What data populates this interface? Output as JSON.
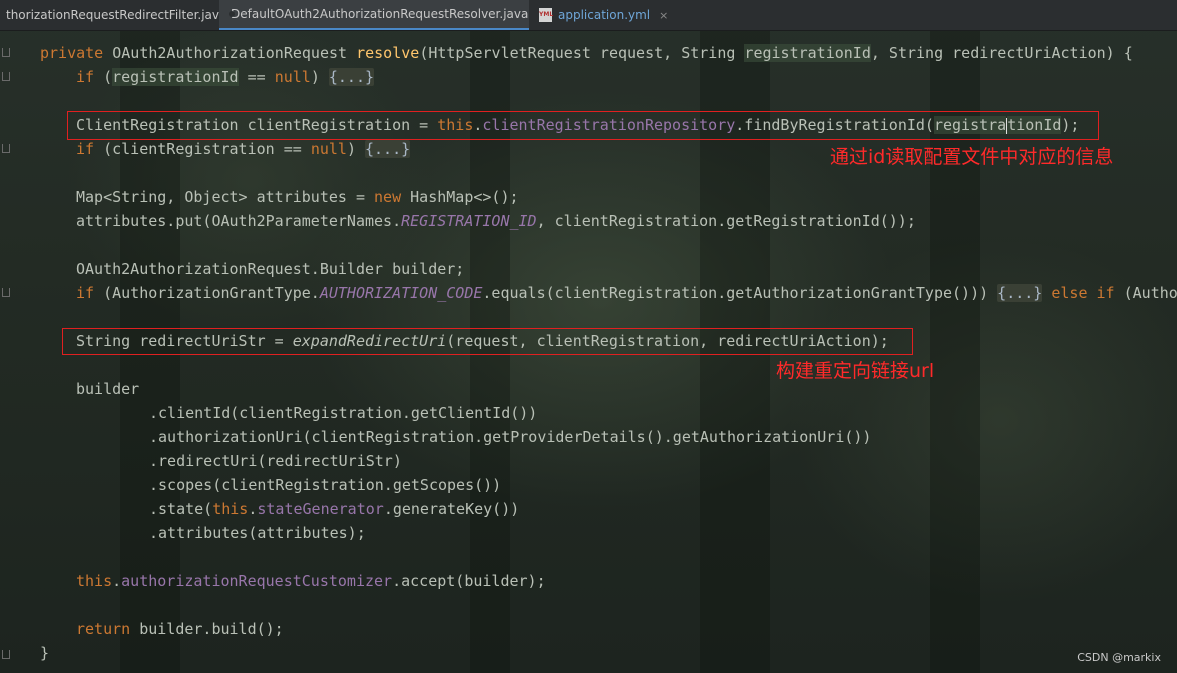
{
  "tabs": [
    {
      "label": "thorizationRequestRedirectFilter.java",
      "icon": "java-file-icon",
      "active": false
    },
    {
      "label": "DefaultOAuth2AuthorizationRequestResolver.java",
      "icon": "java-class-icon",
      "active": true
    },
    {
      "label": "application.yml",
      "icon": "yml-file-icon",
      "active": false
    }
  ],
  "close_glyph": "×",
  "yml_badge": "YML",
  "code": {
    "l1": {
      "t0": "private ",
      "t1": "OAuth2AuthorizationRequest ",
      "t2": "resolve",
      "t3": "(HttpServletRequest request, String ",
      "t4": "registrationId",
      "t5": ", String redirectUriAction) {"
    },
    "l2": {
      "t0": "if ",
      "t1": "(",
      "t2": "registrationId",
      "t3": " == ",
      "t4": "null",
      "t5": ") ",
      "t6": "{...}"
    },
    "l3": {
      "t0": "ClientRegistration clientRegistration = ",
      "t1": "this",
      "t2": ".",
      "t3": "clientRegistrationRepository",
      "t4": ".findByRegistrationId(",
      "t5a": "registra",
      "t5b": "tionId",
      "t6": ");"
    },
    "l4": {
      "t0": "if ",
      "t1": "(clientRegistration == ",
      "t2": "null",
      "t3": ") ",
      "t4": "{...}"
    },
    "l5": {
      "t0": "Map<String, Object> attributes = ",
      "t1": "new ",
      "t2": "HashMap<>();"
    },
    "l6": {
      "t0": "attributes.put(OAuth2ParameterNames.",
      "t1": "REGISTRATION_ID",
      "t2": ", clientRegistration.getRegistrationId());"
    },
    "l7": {
      "t0": "OAuth2AuthorizationRequest.Builder builder;"
    },
    "l8": {
      "t0": "if ",
      "t1": "(AuthorizationGrantType.",
      "t2": "AUTHORIZATION_CODE",
      "t3": ".equals(clientRegistration.getAuthorizationGrantType())) ",
      "t4": "{...}",
      "t5": " else if ",
      "t6": "(Author"
    },
    "l9": {
      "t0": "String redirectUriStr = ",
      "t1": "expandRedirectUri",
      "t2": "(request, clientRegistration, redirectUriAction);"
    },
    "l10": {
      "t0": "builder"
    },
    "l11": {
      "t0": ".clientId(clientRegistration.getClientId())"
    },
    "l12": {
      "t0": ".authorizationUri(clientRegistration.getProviderDetails().getAuthorizationUri())"
    },
    "l13": {
      "t0": ".redirectUri(redirectUriStr)"
    },
    "l14": {
      "t0": ".scopes(clientRegistration.getScopes())"
    },
    "l15": {
      "t0": ".state(",
      "t1": "this",
      "t2": ".",
      "t3": "stateGenerator",
      "t4": ".generateKey())"
    },
    "l16": {
      "t0": ".attributes(attributes);"
    },
    "l17": {
      "t0": "this",
      "t1": ".",
      "t2": "authorizationRequestCustomizer",
      "t3": ".accept(builder);"
    },
    "l18": {
      "t0": "return ",
      "t1": "builder.build();"
    },
    "l19": {
      "t0": "}"
    }
  },
  "annotations": {
    "note1": "通过id读取配置文件中对应的信息",
    "note2": "构建重定向链接url",
    "color": "#e02020"
  },
  "watermark": "CSDN @markix",
  "colors": {
    "keyword": "#cc7832",
    "method": "#ffc66d",
    "field": "#9876aa",
    "text": "#b9c0b6"
  }
}
